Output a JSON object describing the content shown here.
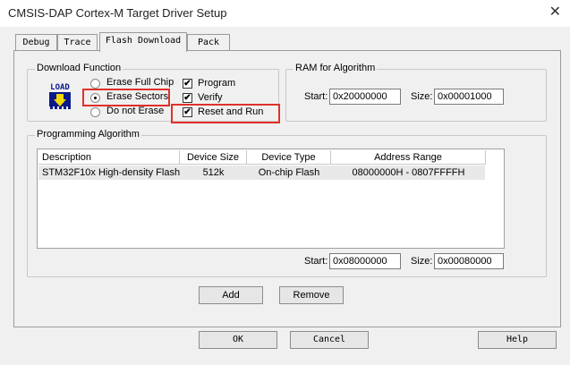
{
  "window": {
    "title": "CMSIS-DAP Cortex-M Target Driver Setup",
    "close_glyph": "✕"
  },
  "tabs": [
    {
      "label": "Debug"
    },
    {
      "label": "Trace"
    },
    {
      "label": "Flash Download"
    },
    {
      "label": "Pack"
    }
  ],
  "download_function": {
    "legend": "Download Function",
    "icon_text": "LOAD",
    "erase_full_chip": "Erase Full Chip",
    "erase_sectors": "Erase Sectors",
    "do_not_erase": "Do not Erase",
    "selected_erase": "Erase Sectors",
    "program": {
      "label": "Program",
      "checked": true
    },
    "verify": {
      "label": "Verify",
      "checked": true
    },
    "reset_and_run": {
      "label": "Reset and Run",
      "checked": true
    }
  },
  "ram": {
    "legend": "RAM for Algorithm",
    "start_label": "Start:",
    "start_value": "0x20000000",
    "size_label": "Size:",
    "size_value": "0x00001000"
  },
  "algorithm": {
    "legend": "Programming Algorithm",
    "columns": [
      "Description",
      "Device Size",
      "Device Type",
      "Address Range"
    ],
    "rows": [
      [
        "STM32F10x High-density Flash",
        "512k",
        "On-chip Flash",
        "08000000H - 0807FFFFH"
      ]
    ],
    "start_label": "Start:",
    "start_value": "0x08000000",
    "size_label": "Size:",
    "size_value": "0x00080000"
  },
  "buttons": {
    "add": "Add",
    "remove": "Remove",
    "ok": "OK",
    "cancel": "Cancel",
    "help": "Help"
  },
  "colors": {
    "highlight": "#e0312a",
    "check_mark": "✔"
  }
}
